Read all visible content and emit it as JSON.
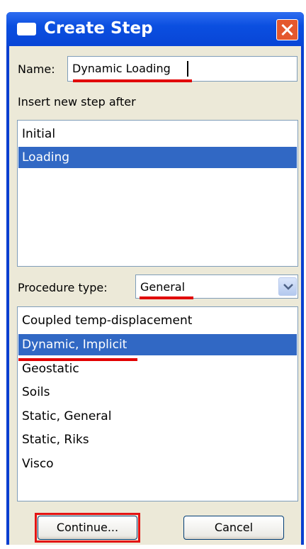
{
  "window": {
    "title": "Create Step",
    "icon": "window-icon",
    "close_icon": "close-icon"
  },
  "name_field": {
    "label": "Name:",
    "value": "Dynamic Loading"
  },
  "insert_after": {
    "label": "Insert new step after",
    "items": [
      "Initial",
      "Loading"
    ],
    "selected": "Loading"
  },
  "procedure": {
    "label": "Procedure type:",
    "value": "General",
    "dropdown_icon": "chevron-down-icon",
    "items": [
      "Coupled temp-displacement",
      "Dynamic, Implicit",
      "Geostatic",
      "Soils",
      "Static, General",
      "Static, Riks",
      "Visco"
    ],
    "selected": "Dynamic, Implicit"
  },
  "buttons": {
    "continue": "Continue...",
    "cancel": "Cancel"
  },
  "colors": {
    "titlebar": "#0b4fe0",
    "selection": "#3168c4",
    "annotation": "#e10000",
    "dialog_bg": "#ece9d8"
  }
}
